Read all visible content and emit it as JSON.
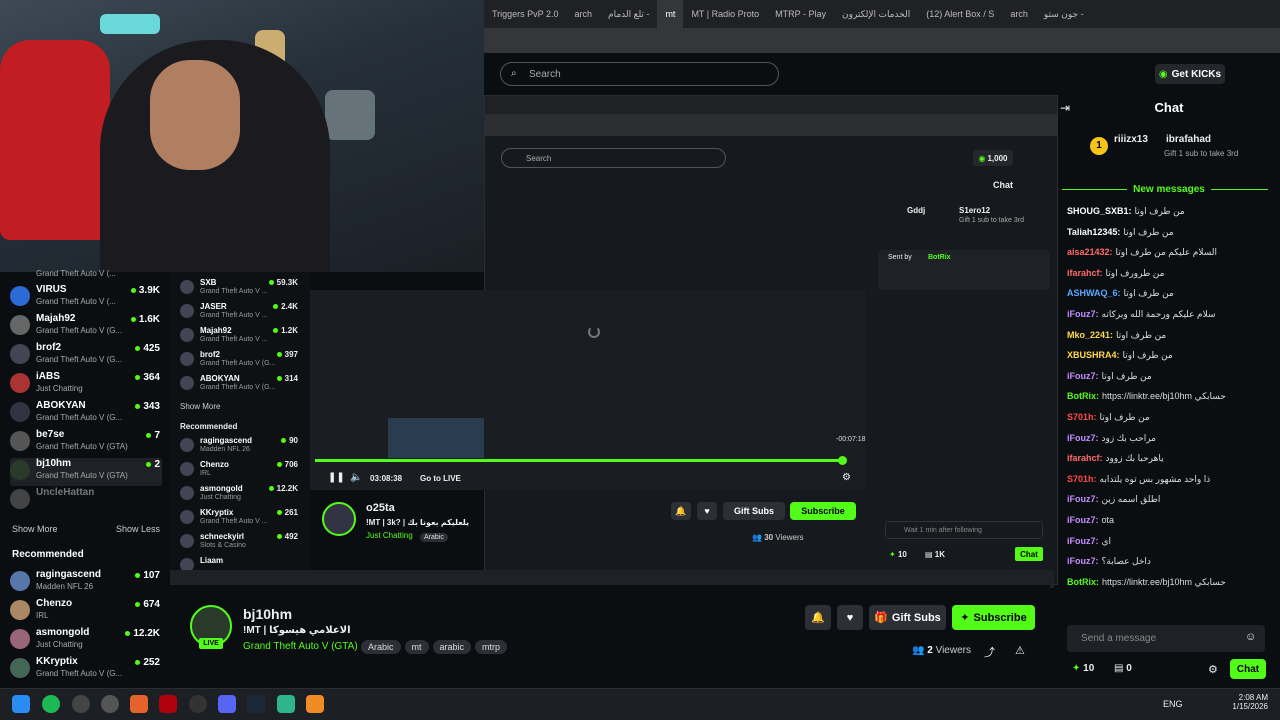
{
  "browser_tabs": [
    "Triggers PvP 2.0",
    "arch",
    "تلع الدمام -",
    "mt",
    "MT | Radio Proto",
    "MTRP - Play",
    "الخدمات الإلكترون",
    "(12) Alert Box / S",
    "arch",
    "جون ستو -"
  ],
  "search": {
    "placeholder": "Search"
  },
  "get_kicks": "Get KICKs",
  "sidebar": {
    "first_cat": "Grand Theft Auto V (...",
    "items": [
      {
        "name": "VIRUS",
        "cat": "Grand Theft Auto V (...",
        "count": "3.9K",
        "color": "#2a6bd6"
      },
      {
        "name": "Majah92",
        "cat": "Grand Theft Auto V (G...",
        "count": "1.6K",
        "color": "#666"
      },
      {
        "name": "brof2",
        "cat": "Grand Theft Auto V (G...",
        "count": "425",
        "color": "#445"
      },
      {
        "name": "iABS",
        "cat": "Just Chatting",
        "count": "364",
        "color": "#a33"
      },
      {
        "name": "ABOKYAN",
        "cat": "Grand Theft Auto V (G...",
        "count": "343",
        "color": "#334"
      },
      {
        "name": "be7se",
        "cat": "Grand Theft Auto V (GTA)",
        "count": "7",
        "color": "#555"
      },
      {
        "name": "bj10hm",
        "cat": "Grand Theft Auto V (GTA)",
        "count": "2",
        "color": "#2a3a2a"
      },
      {
        "name": "UncleHattan",
        "cat": "",
        "count": "",
        "color": "#444"
      }
    ],
    "show_more": "Show More",
    "show_less": "Show Less",
    "recommended": "Recommended",
    "recommended_items": [
      {
        "name": "ragingascend",
        "cat": "Madden NFL 26",
        "count": "107",
        "color": "#5577aa"
      },
      {
        "name": "Chenzo",
        "cat": "IRL",
        "count": "674",
        "color": "#aa8866"
      },
      {
        "name": "asmongold",
        "cat": "Just Chatting",
        "count": "12.2K",
        "color": "#996677"
      },
      {
        "name": "KKryptix",
        "cat": "Grand Theft Auto V (G...",
        "count": "252",
        "color": "#446655"
      }
    ]
  },
  "inner_sidebar": {
    "items": [
      {
        "name": "SXB",
        "cat": "Grand Theft Auto V ...",
        "count": "59.3K"
      },
      {
        "name": "JASER",
        "cat": "Grand Theft Auto V ...",
        "count": "2.4K"
      },
      {
        "name": "Majah92",
        "cat": "Grand Theft Auto V ...",
        "count": "1.2K"
      },
      {
        "name": "brof2",
        "cat": "Grand Theft Auto V (G...",
        "count": "397"
      },
      {
        "name": "ABOKYAN",
        "cat": "Grand Theft Auto V (G...",
        "count": "314"
      }
    ],
    "show_more": "Show More",
    "recommended": "Recommended",
    "rec_items": [
      {
        "name": "ragingascend",
        "cat": "Madden NFL 26",
        "count": "90"
      },
      {
        "name": "Chenzo",
        "cat": "IRL",
        "count": "706"
      },
      {
        "name": "asmongold",
        "cat": "Just Chatting",
        "count": "12.2K"
      },
      {
        "name": "KKryptix",
        "cat": "Grand Theft Auto V ...",
        "count": "261"
      },
      {
        "name": "schneckyirl",
        "cat": "Slots & Casino",
        "count": "492"
      },
      {
        "name": "Liaam",
        "cat": "",
        "count": ""
      }
    ]
  },
  "inner_player": {
    "time": "03:08:38",
    "go_live": "Go to LIVE",
    "remaining": "-00:07:18",
    "streamer": "o25ta",
    "title": "!MT | 3k? | يلعليكم بعونا بك",
    "category": "Just Chatting",
    "tag": "Arabic",
    "viewers": "30",
    "viewers_label": "Viewers",
    "gift_subs": "Gift Subs",
    "subscribe": "Subscribe",
    "kicks": "1,000",
    "chat_title": "Chat",
    "search": "Search",
    "chat_placeholder": "Wait 1 min after following",
    "chat_btn": "Chat",
    "points": "10",
    "subs_count": "1K",
    "pinned_user1": "Gddj",
    "pinned_user2": "S1ero12",
    "pinned_sub": "Gift 1 sub to take 3rd",
    "sent_by": "Sent by",
    "botrix": "BotRix"
  },
  "stream": {
    "streamer": "bj10hm",
    "title": "!MT | الاعلامي هيسوكا",
    "category": "Grand Theft Auto V (GTA)",
    "tags": [
      "Arabic",
      "mt",
      "arabic",
      "mtrp"
    ],
    "viewers": "2",
    "viewers_label": "Viewers",
    "gift_subs": "Gift Subs",
    "subscribe": "Subscribe",
    "live": "LIVE"
  },
  "chat": {
    "title": "Chat",
    "pinned_user1": "riiizx13",
    "pinned_count1": "1",
    "pinned_user2": "ibrafahad",
    "pinned_count2": "1",
    "pinned_sub": "Gift 1 sub to take 3rd",
    "new_messages": "New messages",
    "messages": [
      {
        "user": "SHOUG_SXB1:",
        "text": "من طرف اوتا",
        "color": "#ffffff"
      },
      {
        "user": "Taliah12345:",
        "text": "من طرف اوتا",
        "color": "#ffffff"
      },
      {
        "user": "aisa21432:",
        "text": "السلام عليكم من طرف اوتا",
        "color": "#ff6b6b"
      },
      {
        "user": "ifarahcf:",
        "text": "من طرورف اوتا",
        "color": "#ff6b6b"
      },
      {
        "user": "ASHWAQ_6:",
        "text": "من طرف اوتا",
        "color": "#5aa9ff"
      },
      {
        "user": "iFouz7:",
        "text": "سلام عليكم ورحمة الله وبركاته",
        "color": "#c58cff"
      },
      {
        "user": "Mko_2241:",
        "text": "من طرف اوتا",
        "color": "#ffd84a"
      },
      {
        "user": "XBUSHRA4:",
        "text": "من طرف اوتا",
        "color": "#ffd84a"
      },
      {
        "user": "iFouz7:",
        "text": "من طرف اوتا",
        "color": "#c58cff"
      },
      {
        "user": "BotRix:",
        "text": "https://linktr.ee/bj10hm حسابكي",
        "color": "#53fc18"
      },
      {
        "user": "S701h:",
        "text": "من طرف اوتا",
        "color": "#ff4a4a"
      },
      {
        "user": "iFouz7:",
        "text": "مراحب بك زود",
        "color": "#c58cff"
      },
      {
        "user": "ifarahcf:",
        "text": "ياهرحبا بك زوود",
        "color": "#ff6b6b"
      },
      {
        "user": "S701h:",
        "text": "ذا واحد مشهور بس توه يلتدابه",
        "color": "#ff4a4a"
      },
      {
        "user": "iFouz7:",
        "text": "اطلق اسمه زين",
        "color": "#c58cff"
      },
      {
        "user": "iFouz7:",
        "text": "ota",
        "color": "#c58cff"
      },
      {
        "user": "iFouz7:",
        "text": "اي",
        "color": "#c58cff"
      },
      {
        "user": "iFouz7:",
        "text": "داخل عصابة؟",
        "color": "#c58cff"
      },
      {
        "user": "BotRix:",
        "text": "https://linktr.ee/bj10hm حسابكي",
        "color": "#53fc18"
      }
    ],
    "input_placeholder": "Send a message",
    "points": "10",
    "subs": "0",
    "chat_btn": "Chat"
  },
  "taskbar": {
    "lang": "ENG",
    "time": "2:08 AM",
    "date": "1/15/2026"
  },
  "colors": {
    "accent": "#53fc18",
    "bg": "#0b0e11"
  }
}
